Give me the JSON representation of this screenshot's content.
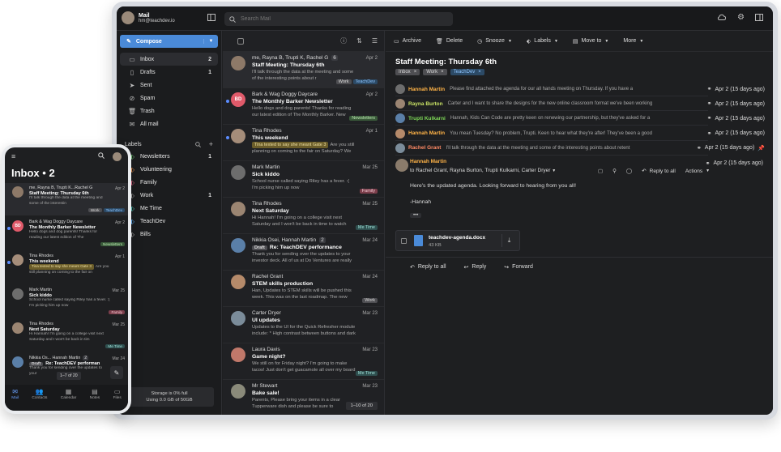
{
  "account": {
    "name": "Mail",
    "email": "hm@teachdev.io"
  },
  "search": {
    "placeholder": "Search Mail"
  },
  "compose": "Compose",
  "folders": [
    {
      "label": "Inbox",
      "count": "2",
      "icon": "inbox-icon"
    },
    {
      "label": "Drafts",
      "count": "1",
      "icon": "file-icon"
    },
    {
      "label": "Sent",
      "count": "",
      "icon": "send-icon"
    },
    {
      "label": "Spam",
      "count": "",
      "icon": "spam-icon"
    },
    {
      "label": "Trash",
      "count": "",
      "icon": "trash-icon"
    },
    {
      "label": "All mail",
      "count": "",
      "icon": "mail-icon"
    }
  ],
  "labels_title": "Labels",
  "labels": [
    {
      "label": "Newsletters",
      "count": "1",
      "color": "#6fbf73"
    },
    {
      "label": "Volunteering",
      "count": "",
      "color": "#e8914f"
    },
    {
      "label": "Family",
      "count": "",
      "color": "#d45b7a"
    },
    {
      "label": "Work",
      "count": "1",
      "color": "#9e9e9e"
    },
    {
      "label": "Me Time",
      "count": "",
      "color": "#4fc3b5"
    },
    {
      "label": "TeachDev",
      "count": "",
      "color": "#5aa9f0"
    },
    {
      "label": "Bills",
      "count": "",
      "color": "#b0b0b0"
    }
  ],
  "storage": {
    "line1": "Storage is 0% full",
    "line2": "Using 0.0 GB of 50GB"
  },
  "messages": [
    {
      "from": "me, Rayna B, Trupti K, Rachel G",
      "count": "6",
      "date": "Apr 2",
      "subject": "Staff Meeting: Thursday 6th",
      "preview": "I'll talk through the data at the meeting and some of the interesting points about r",
      "tags": [
        "Work",
        "TeachDev"
      ]
    },
    {
      "from": "Bark & Wag Doggy Daycare",
      "date": "Apr 2",
      "subject": "The Monthly Barker Newsletter",
      "preview": "Hello dogs and dog parents! Thanks for reading our latest edition of The Monthly Barker. New",
      "tags": [
        "Newsletters"
      ],
      "initials": "BD"
    },
    {
      "from": "Tina Rhodes",
      "date": "Apr 1",
      "subject": "This weekend",
      "highlight": "Tina texted to say she meant Gate 3",
      "preview": "Are you still planning on coming to the fair on Saturday? We were",
      "tags": []
    },
    {
      "from": "Mark Martin",
      "date": "Mar 25",
      "subject": "Sick kiddo",
      "preview": "School nurse called saying Riley has a fever. :( I'm picking him up now",
      "tags": [
        "Family"
      ]
    },
    {
      "from": "Tina Rhodes",
      "date": "Mar 25",
      "subject": "Next Saturday",
      "preview": "Hi Hannah! I'm going on a college visit next Saturday and I won't be back in time to watch Riley in",
      "tags": [
        "Me Time"
      ]
    },
    {
      "from": "Nikkia Osei, Hannah Martin",
      "count": "2",
      "date": "Mar 24",
      "subject": "Re: TeachDEV performance",
      "draft": "Draft",
      "preview": "Thank you for sending over the updates to your investor deck. All of us at Do Ventures are really",
      "tags": []
    },
    {
      "from": "Rachel Grant",
      "date": "Mar 24",
      "subject": "STEM skills production",
      "preview": "Han, Updates to STEM skills will be pushed this week. This was on the last roadmap. The new",
      "tags": [
        "Work"
      ]
    },
    {
      "from": "Carter Dryer",
      "date": "Mar 23",
      "subject": "UI updates",
      "preview": "Updates to the UI for the Quick Refresher module include: * High contrast between buttons and dark",
      "tags": []
    },
    {
      "from": "Laura Davis",
      "date": "Mar 23",
      "subject": "Game night?",
      "preview": "We still on for Friday night? I'm going to make tacos! Just don't get guacamole all over my board",
      "tags": [
        "Me Time"
      ]
    },
    {
      "from": "Mr Stewart",
      "date": "Mar 23",
      "subject": "Bake sale!",
      "preview": "Parents, Please bring your items in a clear Tupperware dish and please be sure to",
      "tags": []
    }
  ],
  "pagination": "1–10 of 20",
  "toolbar": {
    "archive": "Archive",
    "delete": "Delete",
    "snooze": "Snooze",
    "labels": "Labels",
    "move": "Move to",
    "more": "More"
  },
  "thread": {
    "title": "Staff Meeting: Thursday 6th",
    "tags": [
      "Inbox",
      "Work",
      "TeachDev"
    ],
    "rows": [
      {
        "name": "Hannah Martin",
        "color": "#ffb347",
        "preview": "Please find attached the agenda for our all hands meeting on Thursday. If you have a",
        "date": "Apr 2 (15 days ago)"
      },
      {
        "name": "Rayna Burton",
        "color": "#c9e265",
        "preview": "Carter and I want to share the designs for the new online classroom format we've been working",
        "date": "Apr 2 (15 days ago)"
      },
      {
        "name": "Trupti Kulkarni",
        "color": "#7ed957",
        "preview": "Hannah, Kids Can Code are pretty keen on renewing our partnership, but they've asked for a",
        "date": "Apr 2 (15 days ago)"
      },
      {
        "name": "Hannah Martin",
        "color": "#ffb347",
        "preview": "You mean Tuesday? No problem, Trupti. Keen to hear what they're after! They've been a good",
        "date": "Apr 2 (15 days ago)"
      },
      {
        "name": "Rachel Grant",
        "color": "#ff8a65",
        "preview": "I'll talk through the data at the meeting and some of the interesting points about retent",
        "date": "Apr 2 (15 days ago)"
      }
    ],
    "open": {
      "name": "Hannah Martin",
      "date": "Apr 2 (15 days ago)",
      "to": "to Rachel Grant, Rayna Burton, Trupti Kulkarni, Carter Dryer",
      "body1": "Here's the updated agenda. Looking forward to hearing from you all!",
      "body2": "-Hannah",
      "reply_all": "Reply to all",
      "actions": "Actions",
      "attachment": {
        "name": "teachdev-agenda.docx",
        "size": "43 KB"
      }
    },
    "footer": {
      "reply_all": "Reply to all",
      "reply": "Reply",
      "forward": "Forward"
    }
  },
  "phone": {
    "title": "Inbox • 2",
    "pagination": "1–7 of 20",
    "tabs": [
      "Mail",
      "Contacts",
      "Calendar",
      "Notes",
      "Files"
    ],
    "messages": [
      {
        "from": "me, Rayna B, Trupti K...Rachel G",
        "date": "Apr 2",
        "subject": "Staff Meeting: Thursday 6th",
        "preview": "I'll talk through the data at the meeting and some of the interestin",
        "tags": [
          "Work",
          "TeachDev"
        ]
      },
      {
        "from": "Bark & Wag Doggy Daycare",
        "date": "Apr 2",
        "subject": "The Monthly Barker Newsletter",
        "preview": "Hello dogs and dog parents! Thanks for reading our latest edition of The",
        "tags": [
          "Newsletters"
        ],
        "initials": "BD"
      },
      {
        "from": "Tina Rhodes",
        "date": "Apr 1",
        "subject": "This weekend",
        "highlight": "Tina texted to say she meant Gate 3",
        "preview": "Are you still planning on coming to the fair on",
        "tags": []
      },
      {
        "from": "Mark Martin",
        "date": "Mar 25",
        "subject": "Sick kiddo",
        "preview": "School nurse called saying Riley has a fever. :( I'm picking him up now",
        "tags": [
          "Family"
        ]
      },
      {
        "from": "Tina Rhodes",
        "date": "Mar 25",
        "subject": "Next Saturday",
        "preview": "Hi Hannah! I'm going on a college visit next Saturday and I won't be back in tim",
        "tags": [
          "Me Time"
        ]
      },
      {
        "from": "Nikkia Os... Hannah Martin",
        "count": "2",
        "date": "Mar 24",
        "subject": "Re: TeachDEV performan",
        "draft": "Draft",
        "preview": "Thank you for sending over the updates to your",
        "tags": []
      }
    ]
  }
}
